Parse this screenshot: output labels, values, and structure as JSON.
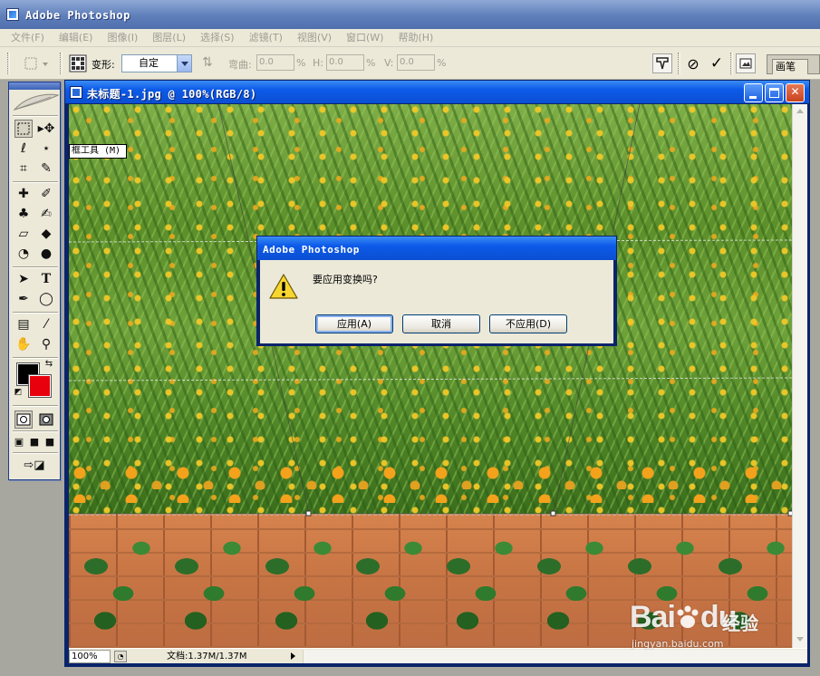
{
  "app": {
    "title": "Adobe Photoshop"
  },
  "menu": {
    "items": [
      {
        "label": "文件(F)"
      },
      {
        "label": "编辑(E)"
      },
      {
        "label": "图像(I)"
      },
      {
        "label": "图层(L)"
      },
      {
        "label": "选择(S)"
      },
      {
        "label": "滤镜(T)"
      },
      {
        "label": "视图(V)"
      },
      {
        "label": "窗口(W)"
      },
      {
        "label": "帮助(H)"
      }
    ]
  },
  "options_bar": {
    "warp_label": "变形:",
    "warp_value": "自定",
    "bend_label": "弯曲:",
    "bend_value": "0.0",
    "h_label": "H:",
    "h_value": "0.0",
    "v_label": "V:",
    "v_value": "0.0",
    "percent": "%",
    "palette_tab": "画笔"
  },
  "toolbox": {
    "tooltip": "框工具 (M)",
    "foreground_color": "#000000",
    "background_color": "#e8000c"
  },
  "document": {
    "title": "未标题-1.jpg @ 100%(RGB/8)",
    "zoom": "100%",
    "doc_size": "文档:1.37M/1.37M"
  },
  "dialog": {
    "title": "Adobe Photoshop",
    "message": "要应用变换吗?",
    "buttons": {
      "apply": "应用(A)",
      "cancel": "取消",
      "dont_apply": "不应用(D)"
    }
  },
  "watermark": {
    "brand": "Bai",
    "brand_suffix": "du",
    "product": "经验",
    "url": "jingyan.baidu.com"
  }
}
